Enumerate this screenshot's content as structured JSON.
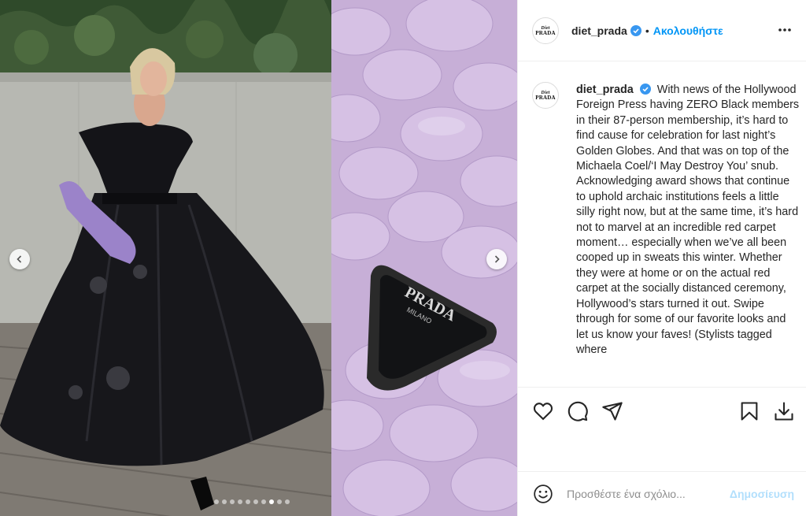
{
  "post": {
    "username": "diet_prada",
    "avatar_logo_top": "Diet",
    "avatar_logo_bottom": "PRADA",
    "separator": "•",
    "follow_label": "Ακολουθήστε",
    "caption": "With news of the Hollywood Foreign Press having ZERO Black members in their 87-person membership, it’s hard to find cause for celebration for last night’s Golden Globes. And that was on top of the Michaela Coel/‘I May Destroy You’ snub. Acknowledging award shows that continue to uphold archaic institutions feels a little silly right now, but at the same time, it’s hard not to marvel at an incredible red carpet moment… especially when we’ve all been cooped up in sweats this winter. Whether they were at home or on the actual red carpet at the socially distanced ceremony, Hollywood’s stars turned it out. Swipe through for some of our favorite looks and let us know your faves! (Stylists tagged where"
  },
  "carousel": {
    "total_slides": 10,
    "active_index": 7,
    "brand_plate_text": "PRADA",
    "brand_plate_sub": "MILANO"
  },
  "actions": {
    "like": "heart-icon",
    "comment": "comment-icon",
    "share": "share-icon",
    "save": "bookmark-icon",
    "download": "download-icon"
  },
  "comment_box": {
    "placeholder": "Προσθέστε ένα σχόλιο...",
    "post_label": "Δημοσίευση"
  },
  "colors": {
    "accent": "#0095f6",
    "post_disabled": "#b2dffc",
    "text": "#262626",
    "muted": "#8e8e8e",
    "border": "#efefef"
  }
}
